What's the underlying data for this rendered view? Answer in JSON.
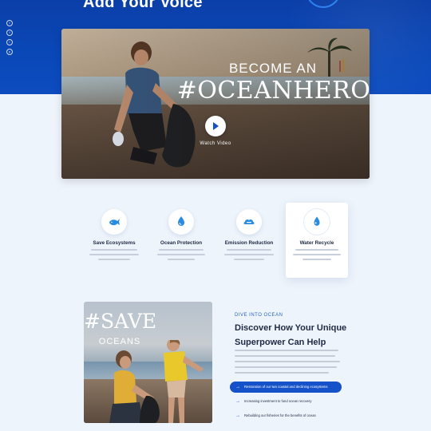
{
  "band": {
    "title": "Add Your Voice"
  },
  "social": [
    "t",
    "f",
    "i",
    "y"
  ],
  "hero": {
    "line1": "BECOME AN",
    "line2": "#OCEANHERO",
    "watch": "Watch Video"
  },
  "features": [
    {
      "title": "Save Ecosystems",
      "icon": "whale-icon",
      "active": false
    },
    {
      "title": "Ocean Protection",
      "icon": "hand-drop-icon",
      "active": false
    },
    {
      "title": "Emission Reduction",
      "icon": "co2-icon",
      "active": false
    },
    {
      "title": "Water Recycle",
      "icon": "water-drop-icon",
      "active": true
    }
  ],
  "photo": {
    "line1": "#SAVE",
    "line2": "OCEANS"
  },
  "about": {
    "eyebrow": "DIVE INTO OCEAN",
    "heading": "Discover How Your Unique Superpower Can Help",
    "checks": [
      {
        "label": "Restoration of our two coastal and declining ecosystems",
        "active": true
      },
      {
        "label": "Increasing investment to fund ocean recovery",
        "active": false
      },
      {
        "label": "Rebuilding our fisheries for the benefits of ocean",
        "active": false
      }
    ]
  },
  "colors": {
    "primary": "#1552c9",
    "band": "#0b3fa8",
    "background": "#eef4fb"
  }
}
